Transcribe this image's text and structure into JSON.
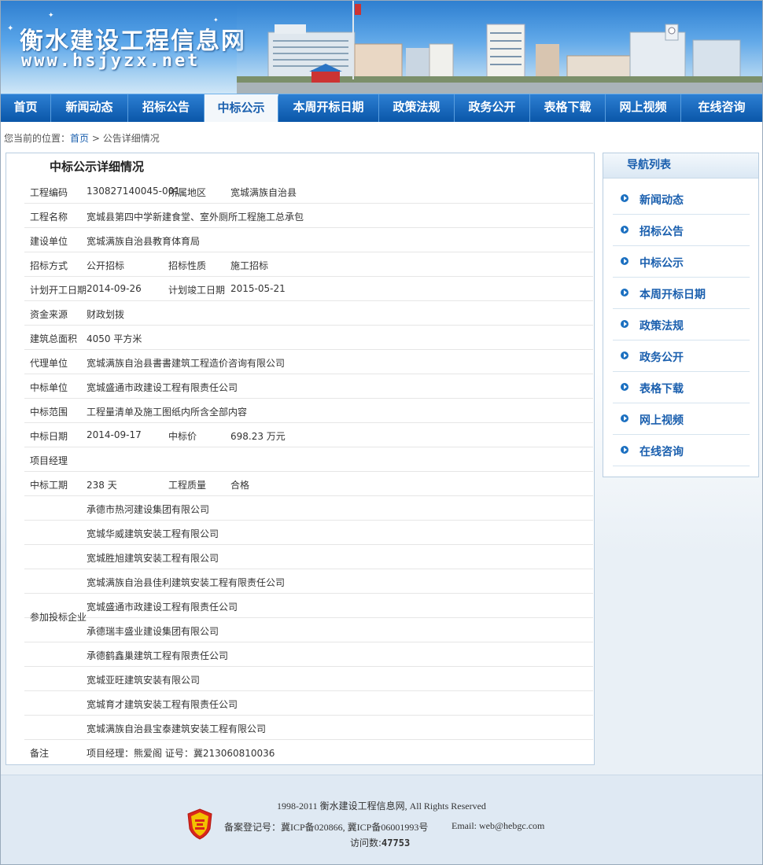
{
  "header": {
    "site_title": "衡水建设工程信息网",
    "site_url": "www.hsjyzx.net"
  },
  "nav": {
    "items": [
      {
        "label": "首页"
      },
      {
        "label": "新闻动态"
      },
      {
        "label": "招标公告"
      },
      {
        "label": "中标公示",
        "active": true
      },
      {
        "label": "本周开标日期"
      },
      {
        "label": "政策法规"
      },
      {
        "label": "政务公开"
      },
      {
        "label": "表格下载"
      },
      {
        "label": "网上视频"
      },
      {
        "label": "在线咨询"
      }
    ]
  },
  "breadcrumb": {
    "prefix": "您当前的位置：",
    "home": "首页",
    "separator": " > ",
    "current": "公告详细情况"
  },
  "main": {
    "title": "中标公示详细情况",
    "project_code_label": "工程编码",
    "project_code": "130827140045-001",
    "region_label": "所属地区",
    "region": "宽城满族自治县",
    "project_name_label": "工程名称",
    "project_name": "宽城县第四中学新建食堂、室外厕所工程施工总承包",
    "builder_label": "建设单位",
    "builder": "宽城满族自治县教育体育局",
    "bid_method_label": "招标方式",
    "bid_method": "公开招标",
    "bid_nature_label": "招标性质",
    "bid_nature": "施工招标",
    "start_date_label": "计划开工日期",
    "start_date": "2014-09-26",
    "end_date_label": "计划竣工日期",
    "end_date": "2015-05-21",
    "funding_label": "资金来源",
    "funding": "财政划拨",
    "area_label": "建筑总面积",
    "area": "4050 平方米",
    "agent_label": "代理单位",
    "agent": "宽城满族自治县書書建筑工程造价咨询有限公司",
    "winner_label": "中标单位",
    "winner": "宽城盛通市政建设工程有限责任公司",
    "scope_label": "中标范围",
    "scope": "工程量清单及施工图纸内所含全部内容",
    "win_date_label": "中标日期",
    "win_date": "2014-09-17",
    "price_label": "中标价",
    "price": "698.23 万元",
    "manager_label": "项目经理",
    "manager": "",
    "duration_label": "中标工期",
    "duration": "238 天",
    "quality_label": "工程质量",
    "quality": "合格",
    "bidders_label": "参加投标企业",
    "bidders": [
      "承德市热河建设集团有限公司",
      "宽城华威建筑安装工程有限公司",
      "宽城胜旭建筑安装工程有限公司",
      "宽城满族自治县佳利建筑安装工程有限责任公司",
      "宽城盛通市政建设工程有限责任公司",
      "承德瑞丰盛业建设集团有限公司",
      "承德鹤鑫巢建筑工程有限责任公司",
      "宽城亚旺建筑安装有限公司",
      "宽城育才建筑安装工程有限责任公司",
      "宽城满族自治县宝泰建筑安装工程有限公司"
    ],
    "remark_label": "备注",
    "remark": "项目经理：熊爱阁 证号：冀213060810036"
  },
  "sidebar": {
    "title": "导航列表",
    "items": [
      {
        "label": "新闻动态"
      },
      {
        "label": "招标公告"
      },
      {
        "label": "中标公示"
      },
      {
        "label": "本周开标日期"
      },
      {
        "label": "政策法规"
      },
      {
        "label": "政务公开"
      },
      {
        "label": "表格下载"
      },
      {
        "label": "网上视频"
      },
      {
        "label": "在线咨询"
      }
    ]
  },
  "footer": {
    "copyright": "1998-2011 衡水建设工程信息网, All Rights Reserved",
    "icp": "备案登记号：冀ICP备020866, 冀ICP备06001993号",
    "email": "Email: web@hebgc.com",
    "visits_label": "访问数:",
    "visits": "47753"
  }
}
